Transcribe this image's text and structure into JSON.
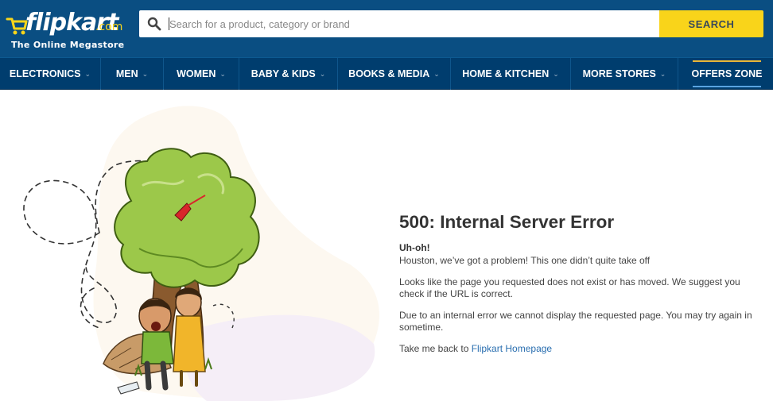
{
  "header": {
    "logo_word": "flipkart",
    "logo_suffix": ".com",
    "logo_tagline": "The Online Megastore",
    "search_placeholder": "Search for a product, category or brand",
    "search_button": "SEARCH"
  },
  "nav": {
    "items": [
      {
        "label": "ELECTRONICS"
      },
      {
        "label": "MEN"
      },
      {
        "label": "WOMEN"
      },
      {
        "label": "BABY & KIDS"
      },
      {
        "label": "BOOKS & MEDIA"
      },
      {
        "label": "HOME & KITCHEN"
      },
      {
        "label": "MORE STORES"
      },
      {
        "label": "OFFERS ZONE"
      }
    ]
  },
  "error": {
    "title": "500: Internal Server Error",
    "exclaim": "Uh-oh!",
    "line1": "Houston, we’ve got a problem! This one didn’t quite take off",
    "line2": "Looks like the page you requested does not exist or has moved. We suggest you check if the URL is correct.",
    "line3": "Due to an internal error we cannot display the requested page. You may try again in sometime.",
    "back_prefix": "Take me back to ",
    "back_link": "Flipkart Homepage"
  },
  "colors": {
    "header_bg": "#0a4e82",
    "nav_bg": "#003d6e",
    "search_button": "#f9d41a",
    "logo_suffix": "#f8d51b",
    "link": "#2a6fb0"
  }
}
